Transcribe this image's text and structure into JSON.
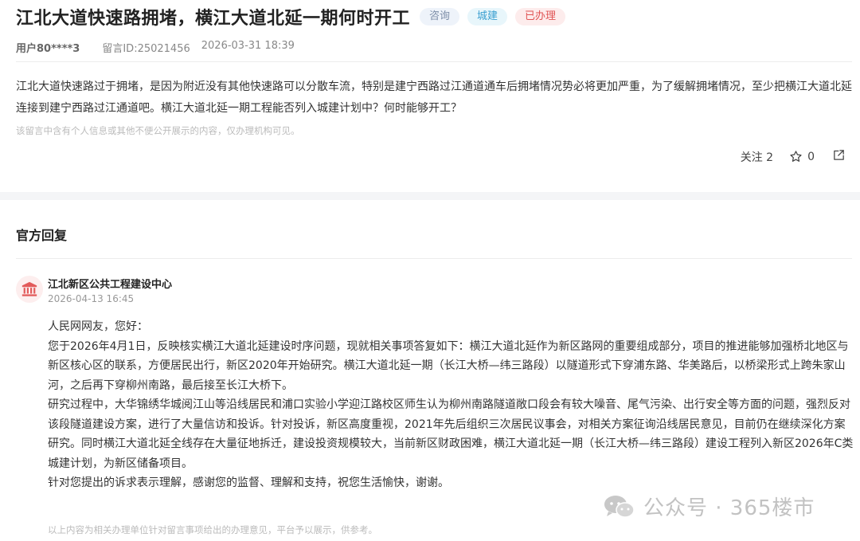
{
  "header": {
    "title": "江北大道快速路拥堵，横江大道北延一期何时开工",
    "tags": [
      "咨询",
      "城建",
      "已办理"
    ],
    "user": "用户80****3",
    "message_id": "留言ID:25021456",
    "datetime": "2026-03-31 18:39"
  },
  "message": {
    "body": "江北大道快速路过于拥堵，是因为附近没有其他快速路可以分散车流，特别是建宁西路过江通道通车后拥堵情况势必将更加严重，为了缓解拥堵情况，至少把横江大道北延连接到建宁西路过江通道吧。横江大道北延一期工程能否列入城建计划中？何时能够开工？",
    "privacy_note": "该留言中含有个人信息或其他不便公开展示的内容，仅办理机构可见。"
  },
  "actions": {
    "follow_label": "关注 2",
    "star_count": "0"
  },
  "reply": {
    "section_title": "官方回复",
    "org_name": "江北新区公共工程建设中心",
    "datetime": "2026-04-13 16:45",
    "paragraphs": [
      "人民网网友，您好：",
      "您于2026年4月1日，反映核实横江大道北延建设时序问题，现就相关事项答复如下：横江大道北延作为新区路网的重要组成部分，项目的推进能够加强桥北地区与新区核心区的联系，方便居民出行，新区2020年开始研究。横江大道北延一期（长江大桥—纬三路段）以隧道形式下穿浦东路、华美路后，以桥梁形式上跨朱家山河，之后再下穿柳州南路，最后接至长江大桥下。",
      "研究过程中，大华锦绣华城阅江山等沿线居民和浦口实验小学迎江路校区师生认为柳州南路隧道敞口段会有较大噪音、尾气污染、出行安全等方面的问题，强烈反对该段隧道建设方案，进行了大量信访和投诉。针对投诉，新区高度重视，2021年先后组织三次居民议事会，对相关方案征询沿线居民意见，目前仍在继续深化方案研究。同时横江大道北延全线存在大量征地拆迁，建设投资规模较大，当前新区财政困难，横江大道北延一期（长江大桥—纬三路段）建设工程列入新区2026年C类城建计划，为新区储备项目。",
      "针对您提出的诉求表示理解，感谢您的监督、理解和支持，祝您生活愉快，谢谢。"
    ],
    "footer_note": "以上内容为相关办理单位针对留言事项给出的办理意见，平台予以展示，供参考。"
  },
  "watermark": {
    "text": "公众号 · 365楼市"
  }
}
